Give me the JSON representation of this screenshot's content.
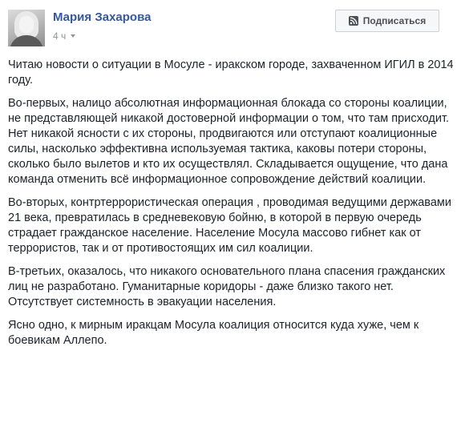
{
  "post": {
    "author": "Мария Захарова",
    "time": "4 ч",
    "subscribe_label": "Подписаться",
    "paragraphs": [
      "Читаю новости о ситуации в Мосуле - иракском городе, захваченном ИГИЛ в 2014 году.",
      "Во-первых, налицо абсолютная информационная блокада со стороны коалиции, не представляющей никакой достоверной информации о том, что там присходит. Нет никакой ясности с их стороны, продвигаются или отступают коалиционные силы, насколько эффективна используемая тактика, каковы потери стороны, сколько было вылетов и кто их осуществлял. Складывается ощущение, что дана команда отменить всё информационное сопровождение действий коалиции.",
      "Во-вторых, контртеррористическая операция , проводимая ведущими державами 21 века, превратилась в средневековую бойню, в которой в первую очередь страдает гражданское население. Население Мосула массово гибнет как от террористов, так и от противостоящих им сил коалиции.",
      "В-третьих, оказалось, что никакого основательного плана спасения гражданских лиц не разработано. Гуманитарные коридоры - даже близко такого нет. Отсутствует системность в эвакуации населения.",
      "Ясно одно, к мирным иракцам Мосула коалиция относится куда хуже, чем к боевикам Аллепо."
    ]
  },
  "icons": {
    "subscribe": "rss-icon",
    "audience": "chevron-down-icon"
  },
  "colors": {
    "author": "#365899",
    "meta": "#90949c",
    "text": "#1d2129",
    "button_bg": "#f6f7f9",
    "button_border": "#ced0d4"
  }
}
